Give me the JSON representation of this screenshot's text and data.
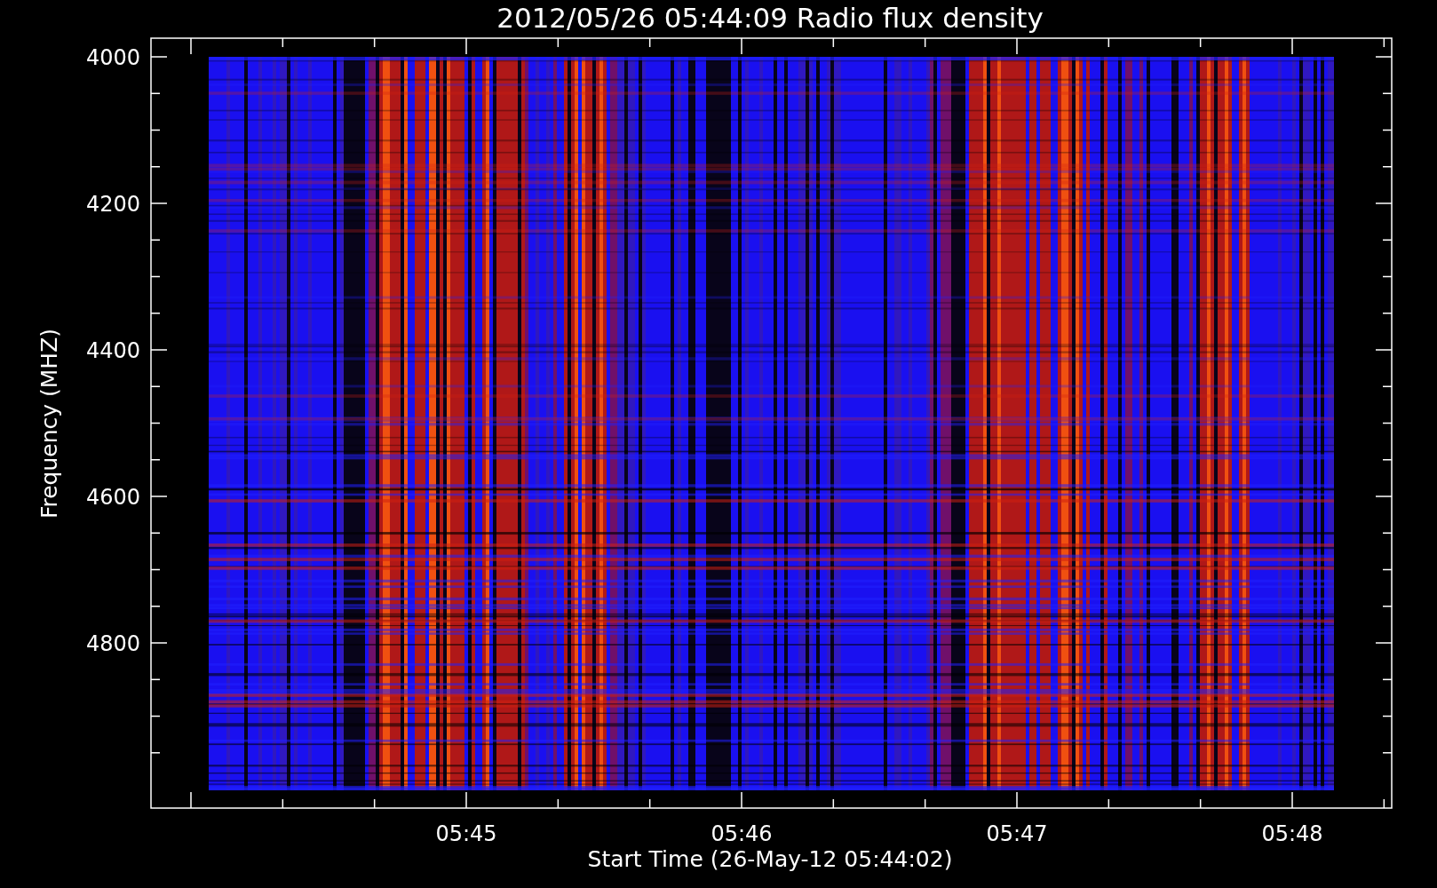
{
  "title": "2012/05/26 05:44:09 Radio flux density",
  "y_axis": {
    "label": "Frequency (MHZ)",
    "ticks": [
      "4000",
      "4200",
      "4400",
      "4600",
      "4800"
    ]
  },
  "x_axis": {
    "label": "Start Time (26-May-12 05:44:02)",
    "ticks": [
      "05:45",
      "05:46",
      "05:47",
      "05:48"
    ]
  }
}
